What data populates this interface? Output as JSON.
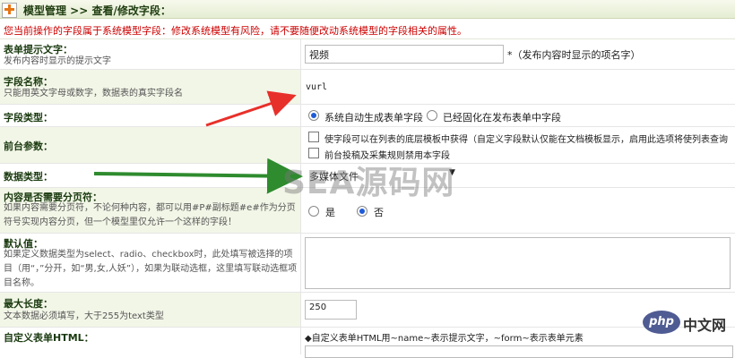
{
  "header": {
    "title": "模型管理 >> 查看/修改字段："
  },
  "warning": "您当前操作的字段属于系统模型字段：修改系统模型有风险，请不要随便改动系统模型的字段相关的属性。",
  "fields": {
    "form_hint": {
      "label": "表单提示文字：",
      "desc": "发布内容时显示的提示文字",
      "value": "视频",
      "note": "*（发布内容时显示的项名字）"
    },
    "field_name": {
      "label": "字段名称：",
      "desc": "只能用英文字母或数字，数据表的真实字段名",
      "value": "vurl"
    },
    "field_type": {
      "label": "字段类型：",
      "options": [
        "系统自动生成表单字段",
        "已经固化在发布表单中字段"
      ],
      "selected": 0
    },
    "frontend_params": {
      "label": "前台参数：",
      "options": [
        "使字段可以在列表的底层模板中获得（自定义字段默认仅能在文档模板显示，启用此选项将使列表查询",
        "前台投稿及采集规则禁用本字段"
      ]
    },
    "data_type": {
      "label": "数据类型：",
      "value": "多媒体文件"
    },
    "pagination": {
      "label": "内容是否需要分页符：",
      "desc": "如果内容需要分页符，不论何种内容，都可以用#P#副标题#e#作为分页符号实现内容分页，但一个模型里仅允许一个这样的字段！",
      "options": [
        "是",
        "否"
      ],
      "selected": 1
    },
    "default_value": {
      "label": "默认值：",
      "desc": "如果定义数据类型为select、radio、checkbox时，此处填写被选择的项目（用“，”分开，如“男,女,人妖”），如果为联动选框，这里填写联动选框项目名称。"
    },
    "max_length": {
      "label": "最大长度：",
      "desc": "文本数据必须填写，大于255为text类型",
      "value": "250"
    },
    "custom_html": {
      "label": "自定义表单HTML：",
      "note": "◆自定义表单HTML用~name~表示提示文字，~form~表示表单元素"
    }
  },
  "overlays": {
    "watermark": "SEA源码网",
    "php_logo": "php",
    "php_text": "中文网",
    "red_arrow": "#e8302a",
    "green_arrow": "#2e8b2e"
  }
}
